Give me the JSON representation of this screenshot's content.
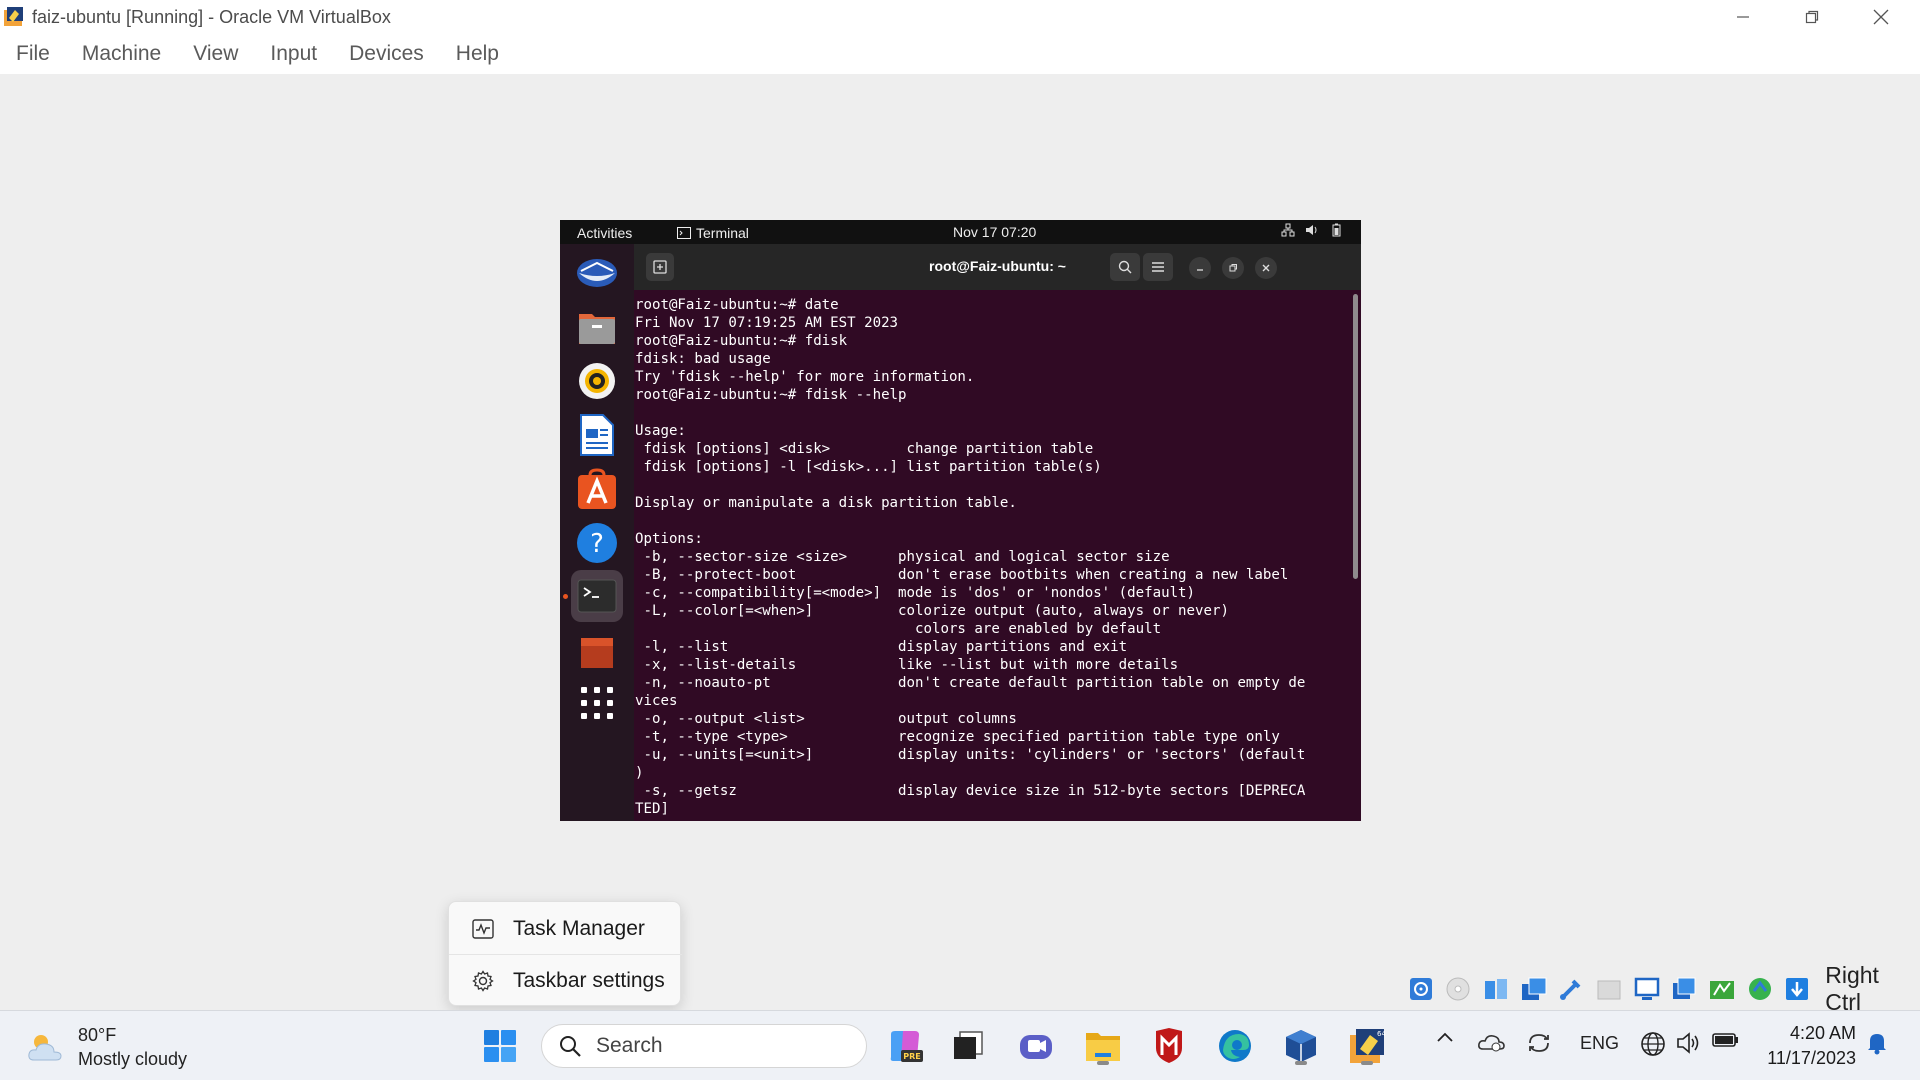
{
  "window": {
    "title": "faiz-ubuntu [Running] - Oracle VM VirtualBox",
    "icon": "virtualbox-icon",
    "controls": [
      "minimize-icon",
      "restore-icon",
      "close-icon"
    ]
  },
  "menubar": {
    "items": [
      "File",
      "Machine",
      "View",
      "Input",
      "Devices",
      "Help"
    ]
  },
  "guest": {
    "topbar": {
      "activities": "Activities",
      "app_name": "Terminal",
      "clock": "Nov 17  07:20",
      "tray_icons": [
        "network-icon",
        "volume-icon",
        "battery-icon"
      ]
    },
    "dock": {
      "apps": [
        "thunderbird-icon",
        "files-icon",
        "rhythmbox-icon",
        "writer-icon",
        "app-center-icon",
        "help-icon",
        "terminal-icon",
        "trash-icon",
        "show-apps-icon"
      ],
      "active": "terminal-icon"
    },
    "terminal": {
      "title": "root@Faiz-ubuntu: ~",
      "lines": [
        "root@Faiz-ubuntu:~# date",
        "Fri Nov 17 07:19:25 AM EST 2023",
        "root@Faiz-ubuntu:~# fdisk",
        "fdisk: bad usage",
        "Try 'fdisk --help' for more information.",
        "root@Faiz-ubuntu:~# fdisk --help",
        "",
        "Usage:",
        " fdisk [options] <disk>         change partition table",
        " fdisk [options] -l [<disk>...] list partition table(s)",
        "",
        "Display or manipulate a disk partition table.",
        "",
        "Options:",
        " -b, --sector-size <size>      physical and logical sector size",
        " -B, --protect-boot            don't erase bootbits when creating a new label",
        " -c, --compatibility[=<mode>]  mode is 'dos' or 'nondos' (default)",
        " -L, --color[=<when>]          colorize output (auto, always or never)",
        "                                 colors are enabled by default",
        " -l, --list                    display partitions and exit",
        " -x, --list-details            like --list but with more details",
        " -n, --noauto-pt               don't create default partition table on empty de",
        "vices",
        " -o, --output <list>           output columns",
        " -t, --type <type>             recognize specified partition table type only",
        " -u, --units[=<unit>]          display units: 'cylinders' or 'sectors' (default",
        ")",
        " -s, --getsz                   display device size in 512-byte sectors [DEPRECA",
        "TED]"
      ]
    }
  },
  "context_menu": {
    "items": [
      {
        "label": "Task Manager",
        "icon": "task-manager-icon"
      },
      {
        "label": "Taskbar settings",
        "icon": "gear-icon"
      }
    ]
  },
  "vbox_status": {
    "icons": [
      "hard-disk-icon",
      "optical-drive-icon",
      "audio-icon",
      "network-icon",
      "usb-icon",
      "shared-folders-icon",
      "display-icon",
      "recording-icon",
      "capture-icon",
      "mouse-integration-icon",
      "keyboard-icon"
    ],
    "host_key": "Right Ctrl"
  },
  "taskbar": {
    "weather": {
      "temp": "80°F",
      "desc": "Mostly cloudy"
    },
    "search_placeholder": "Search",
    "apps": [
      "start-icon",
      "copilot-icon",
      "task-view-icon",
      "teams-icon",
      "file-explorer-icon",
      "mcafee-icon",
      "edge-icon",
      "virtualbox-manager-icon",
      "virtualbox-vm-icon"
    ],
    "tray": {
      "icons": [
        "chevron-up-icon",
        "onedrive-icon",
        "sync-icon"
      ],
      "language": "ENG",
      "system_icons": [
        "globe-icon",
        "speaker-icon",
        "battery-icon"
      ],
      "time": "4:20 AM",
      "date": "11/17/2023"
    },
    "notification_icon": "bell-icon"
  },
  "colors": {
    "terminal_bg": "#300a24",
    "ubuntu_orange": "#e95420",
    "taskbar_bg": "#eef1f6"
  }
}
